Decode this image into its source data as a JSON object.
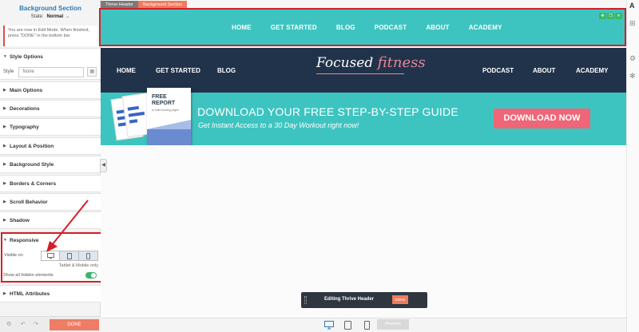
{
  "left_panel": {
    "title": "Background Section",
    "state_label": "State:",
    "state_value": "Normal",
    "notice": "You are now in Edit Mode. When finished, press \"DONE\" in the bottom bar",
    "style_options": {
      "label": "Style Options",
      "style_label": "Style",
      "style_value": "None"
    },
    "sections": [
      "Main Options",
      "Decorations",
      "Typography",
      "Layout & Position",
      "Background Style",
      "Borders & Corners",
      "Scroll Behavior",
      "Shadow"
    ],
    "responsive": {
      "label": "Responsive",
      "visible_on": "Visible on",
      "note": "Tablet & Mobile only",
      "show_hidden": "Show all hidden elements",
      "show_hidden_on": true
    },
    "html_attributes": "HTML Attributes",
    "done": "DONE"
  },
  "canvas": {
    "breadcrumbs": [
      "Thrive Header",
      "Background Section"
    ],
    "thrive_nav": [
      "HOME",
      "GET STARTED",
      "BLOG",
      "PODCAST",
      "ABOUT",
      "ACADEMY"
    ],
    "dark_nav_left": [
      "HOME",
      "GET STARTED",
      "BLOG"
    ],
    "dark_nav_right": [
      "PODCAST",
      "ABOUT",
      "ACADEMY"
    ],
    "logo_part1": "Focused ",
    "logo_part2": "fitness",
    "report_title": "FREE REPORT",
    "report_sub": "to build landing pages",
    "banner_title": "DOWNLOAD YOUR FREE STEP-BY-STEP GUIDE",
    "banner_sub": "Get Instant Access to a 30 Day Workout right now!",
    "banner_button": "DOWNLOAD NOW",
    "edit_bar_label": "Editing Thrive Header",
    "edit_bar_done": "DONE"
  },
  "bottom_bar": {
    "preview": "Preview"
  },
  "colors": {
    "teal": "#3ec4c0",
    "navy": "#21334a",
    "accent": "#f07a5c",
    "pink_button": "#ee6677",
    "highlight_red": "#d21f2a"
  }
}
